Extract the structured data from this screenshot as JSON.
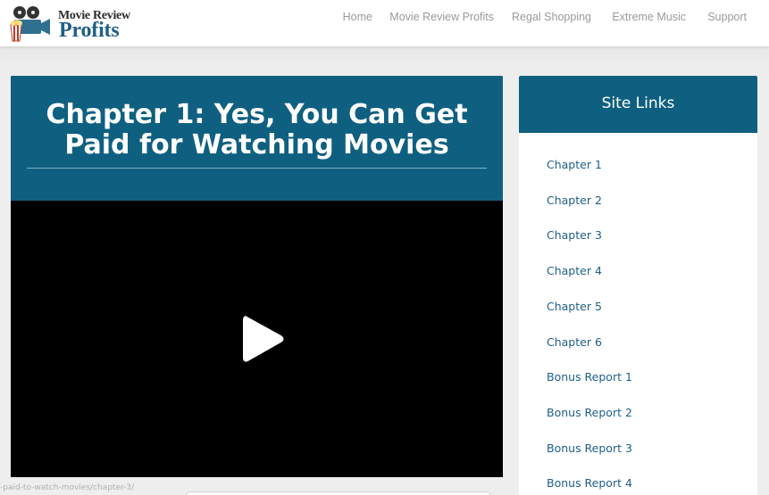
{
  "logo": {
    "line1": "Movie Review",
    "line2": "Profits",
    "icon": "film-reel-popcorn-icon"
  },
  "nav": {
    "items": [
      "Home",
      "Movie Review Profits",
      "Regal Shopping",
      "Extreme Music",
      "Support"
    ]
  },
  "main": {
    "title": "Chapter 1: Yes, You Can Get Paid for Watching Movies",
    "video": {
      "play_icon": "play-icon"
    }
  },
  "sidebar": {
    "title": "Site Links",
    "links": [
      "Chapter 1",
      "Chapter 2",
      "Chapter 3",
      "Chapter 4",
      "Chapter 5",
      "Chapter 6",
      "Bonus Report 1",
      "Bonus Report 2",
      "Bonus Report 3",
      "Bonus Report 4"
    ]
  },
  "status": {
    "url": "-paid-to-watch-movies/chapter-3/"
  },
  "colors": {
    "brand_blue": "#0f6080",
    "link_blue": "#1f5f86",
    "nav_gray": "#9a9a9a"
  }
}
